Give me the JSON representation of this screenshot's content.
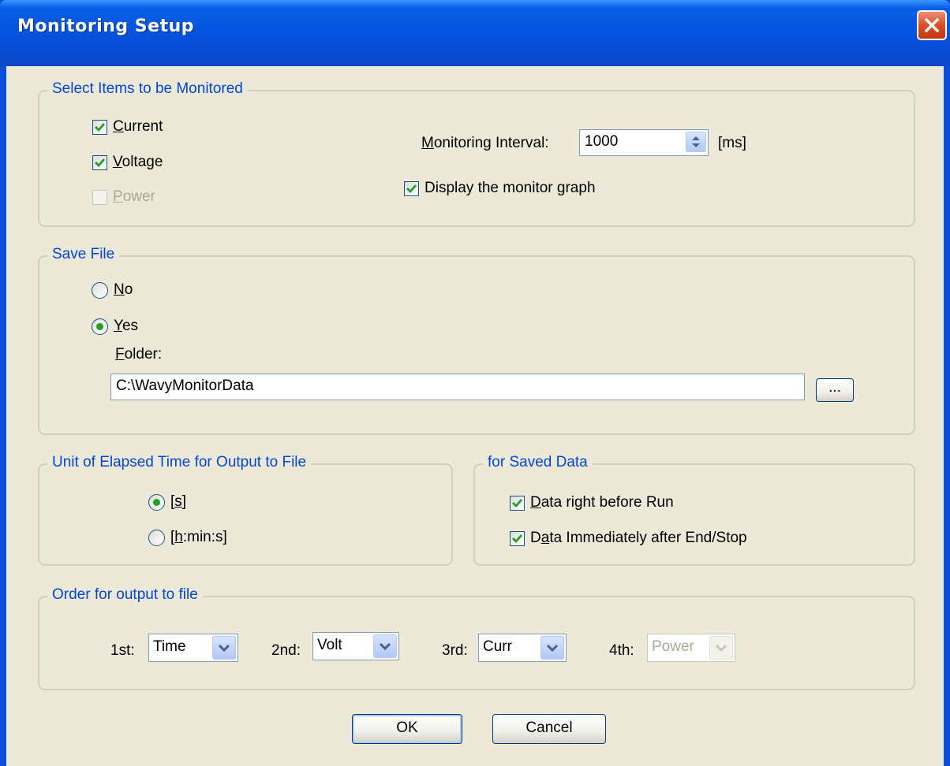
{
  "window": {
    "title": "Monitoring Setup"
  },
  "monitor_group": {
    "legend": "Select Items to be Monitored",
    "current": {
      "mn": "C",
      "rest": "urrent",
      "checked": true,
      "enabled": true
    },
    "voltage": {
      "mn": "V",
      "rest": "oltage",
      "checked": true,
      "enabled": true
    },
    "power": {
      "mn": "P",
      "rest": "ower",
      "checked": false,
      "enabled": false
    },
    "interval_label_mn": "M",
    "interval_label_rest": "onitoring Interval:",
    "interval_value": "1000",
    "interval_unit": "[ms]",
    "display_graph": {
      "pre": "Display the monitor ",
      "mn": "g",
      "post": "raph",
      "checked": true
    }
  },
  "save_group": {
    "legend": "Save File",
    "no": {
      "mn": "N",
      "rest": "o",
      "selected": false
    },
    "yes": {
      "mn": "Y",
      "rest": "es",
      "selected": true
    },
    "folder_label_mn": "F",
    "folder_label_rest": "older:",
    "folder_path": "C:\\WavyMonitorData",
    "browse_label": "..."
  },
  "unit_group": {
    "legend": "Unit of Elapsed Time for Output to File",
    "seconds": {
      "pre": "[",
      "mn": "s",
      "post": "]",
      "selected": true
    },
    "hms": {
      "pre": "[",
      "mn": "h",
      "post": ":min:s]",
      "selected": false
    }
  },
  "saved_data_group": {
    "legend": "for Saved Data",
    "before_run": {
      "pre": "",
      "mn": "D",
      "post": "ata right before Run",
      "checked": true
    },
    "after_end": {
      "pre": "D",
      "mn": "a",
      "post": "ta Immediately after End/Stop",
      "checked": true
    }
  },
  "order_group": {
    "legend": "Order for output to file",
    "items": [
      {
        "label": "1st:",
        "value": "Time",
        "enabled": true
      },
      {
        "label": "2nd:",
        "value": "Volt",
        "enabled": true
      },
      {
        "label": "3rd:",
        "value": "Curr",
        "enabled": true
      },
      {
        "label": "4th:",
        "value": "Power",
        "enabled": false
      }
    ]
  },
  "buttons": {
    "ok": "OK",
    "cancel": "Cancel"
  },
  "colors": {
    "title_bar": "#0550dd",
    "face": "#ece9d8",
    "legend_text": "#0046d5",
    "check_mark": "#21a121",
    "close": "#d44a23"
  }
}
